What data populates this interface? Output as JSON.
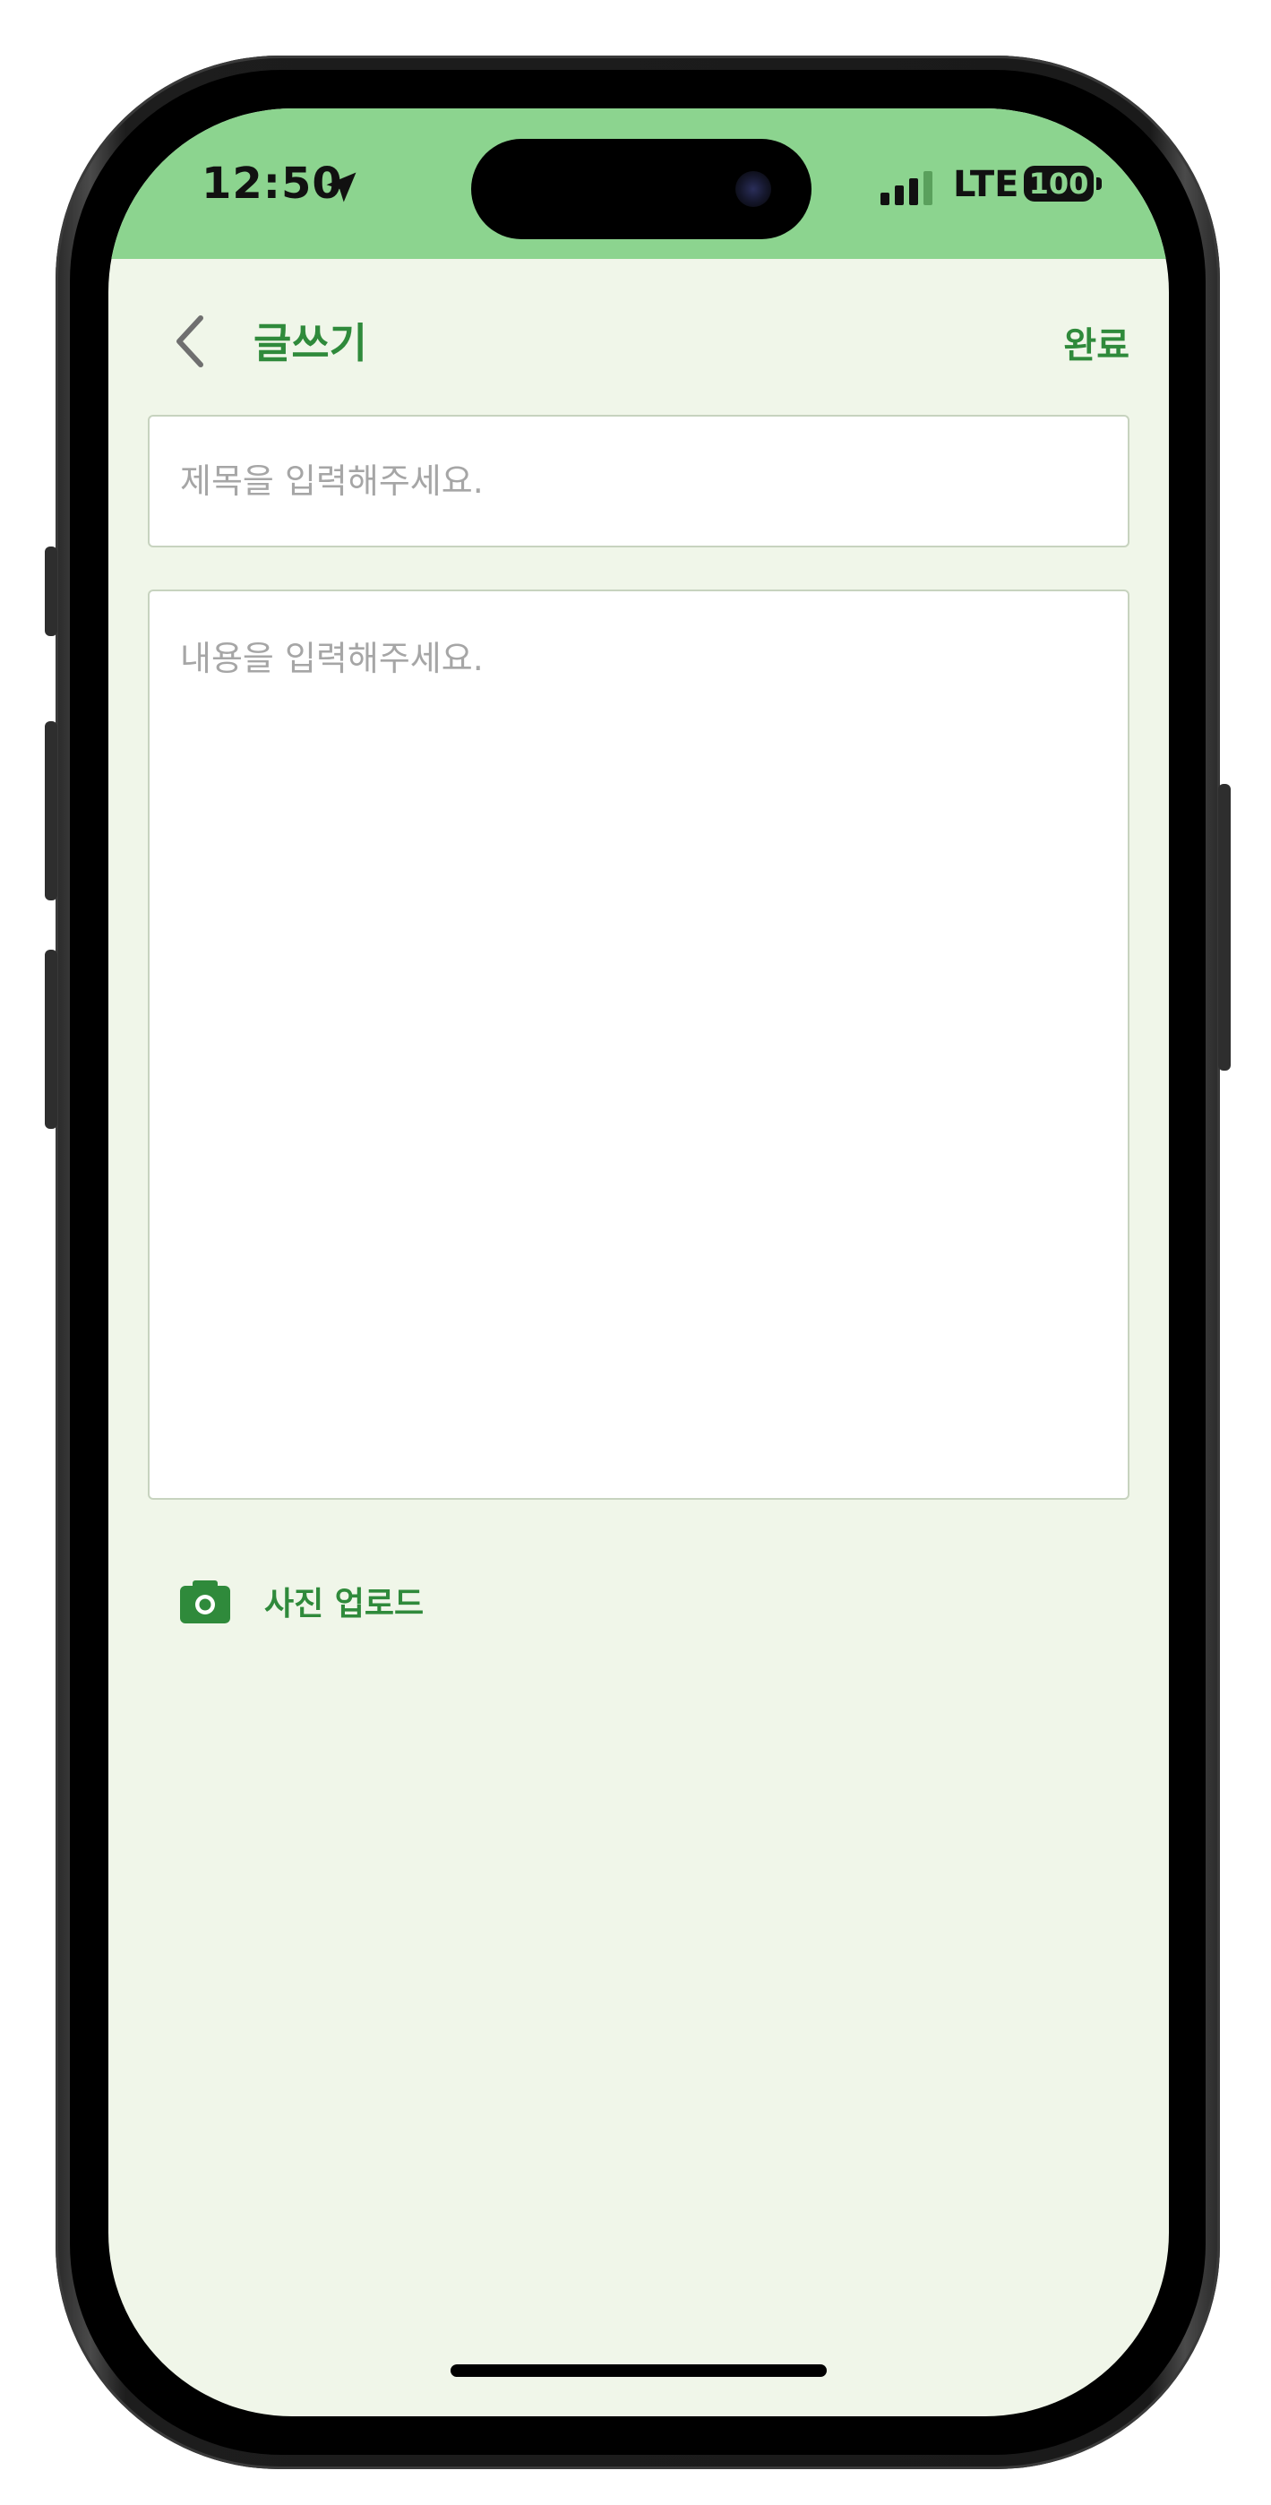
{
  "status_bar": {
    "time": "12:50",
    "network": "LTE",
    "battery": "100"
  },
  "header": {
    "title": "글쓰기",
    "done_label": "완료"
  },
  "form": {
    "title_placeholder": "제목을 입력해주세요.",
    "content_placeholder": "내용을 입력해주세요.",
    "photo_upload_label": "사진 업로드"
  },
  "colors": {
    "status_bar": "#8cd48f",
    "background": "#f0f6e9",
    "accent": "#2f8a3b",
    "input_border": "#c7d3bf"
  },
  "icons": {
    "back": "chevron-left-icon",
    "camera": "camera-icon",
    "location": "location-arrow-icon"
  }
}
